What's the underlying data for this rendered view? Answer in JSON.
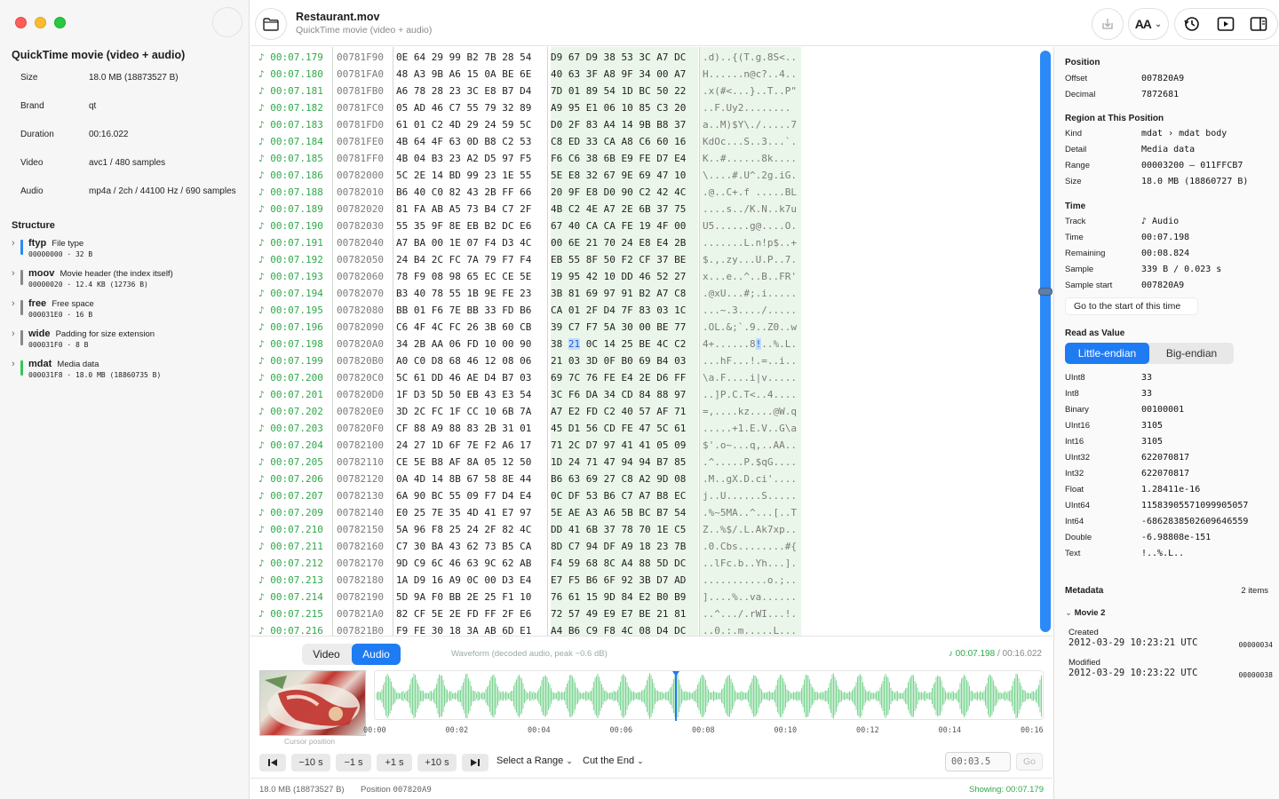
{
  "file": {
    "name": "Restaurant.mov",
    "subtitle": "QuickTime movie (video + audio)",
    "kind": "QuickTime movie (video + audio)"
  },
  "sidebar": {
    "info": [
      {
        "key": "Size",
        "value": "18.0 MB (18873527 B)"
      },
      {
        "key": "Brand",
        "value": "qt"
      },
      {
        "key": "Duration",
        "value": "00:16.022"
      },
      {
        "key": "Video",
        "value": "avc1 / 480 samples"
      },
      {
        "key": "Audio",
        "value": "mp4a / 2ch / 44100 Hz / 690 samples"
      }
    ],
    "structure_title": "Structure",
    "boxes": [
      {
        "name": "ftyp",
        "desc": "File type",
        "meta": "00000000 · 32 B",
        "color": "#2b8af7"
      },
      {
        "name": "moov",
        "desc": "Movie header (the index itself)",
        "meta": "00000020 · 12.4 KB (12736 B)",
        "color": "#888888"
      },
      {
        "name": "free",
        "desc": "Free space",
        "meta": "000031E0 · 16 B",
        "color": "#888888"
      },
      {
        "name": "wide",
        "desc": "Padding for size extension",
        "meta": "000031F0 · 8 B",
        "color": "#888888"
      },
      {
        "name": "mdat",
        "desc": "Media data",
        "meta": "000031F8 · 18.0 MB (18860735 B)",
        "color": "#34c759"
      }
    ]
  },
  "toolbar": {
    "text_size_label": "AA"
  },
  "hex": {
    "rows": [
      {
        "time": "♪ 00:07.179",
        "offset": "00781F90",
        "h1": "0E 64 29 99 B2 7B 28 54",
        "h2": "D9 67 D9 38 53 3C A7 DC",
        "ascii": ".d)..{(T.g.8S<.."
      },
      {
        "time": "♪ 00:07.180",
        "offset": "00781FA0",
        "h1": "48 A3 9B A6 15 0A BE 6E",
        "h2": "40 63 3F A8 9F 34 00 A7",
        "ascii": "H......n@c?..4.."
      },
      {
        "time": "♪ 00:07.181",
        "offset": "00781FB0",
        "h1": "A6 78 28 23 3C E8 B7 D4",
        "h2": "7D 01 89 54 1D BC 50 22",
        "ascii": ".x(#<...}..T..P\""
      },
      {
        "time": "♪ 00:07.182",
        "offset": "00781FC0",
        "h1": "05 AD 46 C7 55 79 32 89",
        "h2": "A9 95 E1 06 10 85 C3 20",
        "ascii": "..F.Uy2........ "
      },
      {
        "time": "♪ 00:07.183",
        "offset": "00781FD0",
        "h1": "61 01 C2 4D 29 24 59 5C",
        "h2": "D0 2F 83 A4 14 9B B8 37",
        "ascii": "a..M)$Y\\./.....7"
      },
      {
        "time": "♪ 00:07.184",
        "offset": "00781FE0",
        "h1": "4B 64 4F 63 0D B8 C2 53",
        "h2": "C8 ED 33 CA A8 C6 60 16",
        "ascii": "KdOc...S..3...`."
      },
      {
        "time": "♪ 00:07.185",
        "offset": "00781FF0",
        "h1": "4B 04 B3 23 A2 D5 97 F5",
        "h2": "F6 C6 38 6B E9 FE D7 E4",
        "ascii": "K..#......8k...."
      },
      {
        "time": "♪ 00:07.186",
        "offset": "00782000",
        "h1": "5C 2E 14 BD 99 23 1E 55",
        "h2": "5E E8 32 67 9E 69 47 10",
        "ascii": "\\....#.U^.2g.iG."
      },
      {
        "time": "♪ 00:07.188",
        "offset": "00782010",
        "h1": "B6 40 C0 82 43 2B FF 66",
        "h2": "20 9F E8 D0 90 C2 42 4C",
        "ascii": ".@..C+.f .....BL"
      },
      {
        "time": "♪ 00:07.189",
        "offset": "00782020",
        "h1": "81 FA AB A5 73 B4 C7 2F",
        "h2": "4B C2 4E A7 2E 6B 37 75",
        "ascii": "....s../K.N..k7u"
      },
      {
        "time": "♪ 00:07.190",
        "offset": "00782030",
        "h1": "55 35 9F 8E EB B2 DC E6",
        "h2": "67 40 CA CA FE 19 4F 00",
        "ascii": "U5......g@....O."
      },
      {
        "time": "♪ 00:07.191",
        "offset": "00782040",
        "h1": "A7 BA 00 1E 07 F4 D3 4C",
        "h2": "00 6E 21 70 24 E8 E4 2B",
        "ascii": ".......L.n!p$..+"
      },
      {
        "time": "♪ 00:07.192",
        "offset": "00782050",
        "h1": "24 B4 2C FC 7A 79 F7 F4",
        "h2": "EB 55 8F 50 F2 CF 37 BE",
        "ascii": "$.,.zy...U.P..7."
      },
      {
        "time": "♪ 00:07.193",
        "offset": "00782060",
        "h1": "78 F9 08 98 65 EC CE 5E",
        "h2": "19 95 42 10 DD 46 52 27",
        "ascii": "x...e..^..B..FR'"
      },
      {
        "time": "♪ 00:07.194",
        "offset": "00782070",
        "h1": "B3 40 78 55 1B 9E FE 23",
        "h2": "3B 81 69 97 91 B2 A7 C8",
        "ascii": ".@xU...#;.i....."
      },
      {
        "time": "♪ 00:07.195",
        "offset": "00782080",
        "h1": "BB 01 F6 7E BB 33 FD B6",
        "h2": "CA 01 2F D4 7F 83 03 1C",
        "ascii": "...~.3..../....."
      },
      {
        "time": "♪ 00:07.196",
        "offset": "00782090",
        "h1": "C6 4F 4C FC 26 3B 60 CB",
        "h2": "39 C7 F7 5A 30 00 BE 77",
        "ascii": ".OL.&;`.9..Z0..w"
      },
      {
        "time": "♪ 00:07.198",
        "offset": "007820A0",
        "h1": "34 2B AA 06 FD 10 00 90",
        "h2": "38 21 0C 14 25 BE 4C C2",
        "ascii": "4+......8!..%.L.",
        "selected": true
      },
      {
        "time": "♪ 00:07.199",
        "offset": "007820B0",
        "h1": "A0 C0 D8 68 46 12 08 06",
        "h2": "21 03 3D 0F B0 69 B4 03",
        "ascii": "...hF...!.=..i.."
      },
      {
        "time": "♪ 00:07.200",
        "offset": "007820C0",
        "h1": "5C 61 DD 46 AE D4 B7 03",
        "h2": "69 7C 76 FE E4 2E D6 FF",
        "ascii": "\\a.F....i|v....."
      },
      {
        "time": "♪ 00:07.201",
        "offset": "007820D0",
        "h1": "1F D3 5D 50 EB 43 E3 54",
        "h2": "3C F6 DA 34 CD 84 88 97",
        "ascii": "..]P.C.T<..4...."
      },
      {
        "time": "♪ 00:07.202",
        "offset": "007820E0",
        "h1": "3D 2C FC 1F CC 10 6B 7A",
        "h2": "A7 E2 FD C2 40 57 AF 71",
        "ascii": "=,....kz....@W.q"
      },
      {
        "time": "♪ 00:07.203",
        "offset": "007820F0",
        "h1": "CF 88 A9 88 83 2B 31 01",
        "h2": "45 D1 56 CD FE 47 5C 61",
        "ascii": ".....+1.E.V..G\\a"
      },
      {
        "time": "♪ 00:07.204",
        "offset": "00782100",
        "h1": "24 27 1D 6F 7E F2 A6 17",
        "h2": "71 2C D7 97 41 41 05 09",
        "ascii": "$'.o~...q,..AA.."
      },
      {
        "time": "♪ 00:07.205",
        "offset": "00782110",
        "h1": "CE 5E B8 AF 8A 05 12 50",
        "h2": "1D 24 71 47 94 94 B7 85",
        "ascii": ".^.....P.$qG...."
      },
      {
        "time": "♪ 00:07.206",
        "offset": "00782120",
        "h1": "0A 4D 14 8B 67 58 8E 44",
        "h2": "B6 63 69 27 C8 A2 9D 08",
        "ascii": ".M..gX.D.ci'...."
      },
      {
        "time": "♪ 00:07.207",
        "offset": "00782130",
        "h1": "6A 90 BC 55 09 F7 D4 E4",
        "h2": "0C DF 53 B6 C7 A7 B8 EC",
        "ascii": "j..U......S....."
      },
      {
        "time": "♪ 00:07.209",
        "offset": "00782140",
        "h1": "E0 25 7E 35 4D 41 E7 97",
        "h2": "5E AE A3 A6 5B BC B7 54",
        "ascii": ".%~5MA..^...[..T"
      },
      {
        "time": "♪ 00:07.210",
        "offset": "00782150",
        "h1": "5A 96 F8 25 24 2F 82 4C",
        "h2": "DD 41 6B 37 78 70 1E C5",
        "ascii": "Z..%$/.L.Ak7xp.."
      },
      {
        "time": "♪ 00:07.211",
        "offset": "00782160",
        "h1": "C7 30 BA 43 62 73 B5 CA",
        "h2": "8D C7 94 DF A9 18 23 7B",
        "ascii": ".0.Cbs........#{"
      },
      {
        "time": "♪ 00:07.212",
        "offset": "00782170",
        "h1": "9D C9 6C 46 63 9C 62 AB",
        "h2": "F4 59 68 8C A4 88 5D DC",
        "ascii": "..lFc.b..Yh...]."
      },
      {
        "time": "♪ 00:07.213",
        "offset": "00782180",
        "h1": "1A D9 16 A9 0C 00 D3 E4",
        "h2": "E7 F5 B6 6F 92 3B D7 AD",
        "ascii": "...........o.;.."
      },
      {
        "time": "♪ 00:07.214",
        "offset": "00782190",
        "h1": "5D 9A F0 BB 2E 25 F1 10",
        "h2": "76 61 15 9D 84 E2 B0 B9",
        "ascii": "]....%..va......"
      },
      {
        "time": "♪ 00:07.215",
        "offset": "007821A0",
        "h1": "82 CF 5E 2E FD FF 2F E6",
        "h2": "72 57 49 E9 E7 BE 21 81",
        "ascii": "..^.../.rWI...!."
      },
      {
        "time": "♪ 00:07.216",
        "offset": "007821B0",
        "h1": "F9 FE 30 18 3A AB 6D E1",
        "h2": "A4 B6 C9 F8 4C 08 D4 DC",
        "ascii": "..0.:.m.....L..."
      }
    ]
  },
  "media": {
    "tab_video": "Video",
    "tab_audio": "Audio",
    "waveform_caption": "Waveform (decoded audio, peak −0.6 dB)",
    "current_time": "♪ 00:07.198",
    "total_time": "/ 00:16.022",
    "thumb_caption": "Cursor position",
    "playhead_fraction": 0.4493,
    "ticks": [
      "00:00",
      "00:02",
      "00:04",
      "00:06",
      "00:08",
      "00:10",
      "00:12",
      "00:14",
      "00:16"
    ],
    "buttons": {
      "back10": "−10 s",
      "back1": "−1 s",
      "fwd1": "+1 s",
      "fwd10": "+10 s",
      "select_range": "Select a Range",
      "cut_end": "Cut the End",
      "goto_value": "00:03.5",
      "go": "Go"
    }
  },
  "status": {
    "size": "18.0 MB (18873527 B)",
    "position_label": "Position",
    "position_value": "007820A9",
    "showing": "Showing: 00:07.179"
  },
  "inspector": {
    "position": {
      "title": "Position",
      "rows": [
        {
          "key": "Offset",
          "value": "007820A9"
        },
        {
          "key": "Decimal",
          "value": "7872681"
        }
      ]
    },
    "region": {
      "title": "Region at This Position",
      "rows": [
        {
          "key": "Kind",
          "value": "mdat › mdat body"
        },
        {
          "key": "Detail",
          "value": "Media data"
        },
        {
          "key": "Range",
          "value": "00003200 – 011FFCB7"
        },
        {
          "key": "Size",
          "value": "18.0 MB (18860727 B)"
        }
      ]
    },
    "time": {
      "title": "Time",
      "rows": [
        {
          "key": "Track",
          "value": "♪ Audio"
        },
        {
          "key": "Time",
          "value": "00:07.198"
        },
        {
          "key": "Remaining",
          "value": "00:08.824"
        },
        {
          "key": "Sample",
          "value": "339 B / 0.023 s"
        },
        {
          "key": "Sample start",
          "value": "007820A9"
        }
      ],
      "goto_start_label": "Go to the start of this time"
    },
    "value": {
      "title": "Read as Value",
      "little_endian": "Little-endian",
      "big_endian": "Big-endian",
      "rows": [
        {
          "key": "UInt8",
          "value": "33"
        },
        {
          "key": "Int8",
          "value": "33"
        },
        {
          "key": "Binary",
          "value": "00100001"
        },
        {
          "key": "UInt16",
          "value": "3105"
        },
        {
          "key": "Int16",
          "value": "3105"
        },
        {
          "key": "UInt32",
          "value": "622070817"
        },
        {
          "key": "Int32",
          "value": "622070817"
        },
        {
          "key": "Float",
          "value": "1.28411e-16"
        },
        {
          "key": "UInt64",
          "value": "11583905571099905057"
        },
        {
          "key": "Int64",
          "value": "-6862838502609646559"
        },
        {
          "key": "Double",
          "value": "-6.98808e-151"
        },
        {
          "key": "Text",
          "value": "!..%.L.."
        }
      ]
    },
    "metadata": {
      "title": "Metadata",
      "count": "2 items",
      "movie_label": "Movie  2",
      "entries": [
        {
          "label": "Created",
          "value": "2012-03-29 10:23:21 UTC",
          "offset": "00000034"
        },
        {
          "label": "Modified",
          "value": "2012-03-29 10:23:22 UTC",
          "offset": "00000038"
        }
      ]
    }
  }
}
